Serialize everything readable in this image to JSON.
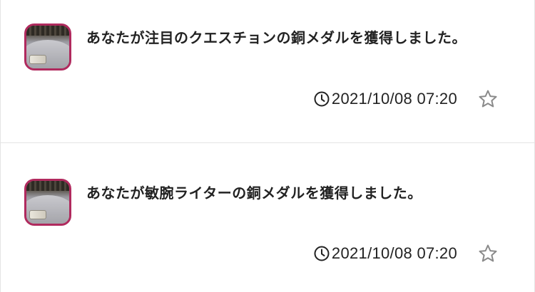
{
  "notifications": [
    {
      "message": "あなたが注目のクエスチョンの銅メダルを獲得しました。",
      "timestamp": "2021/10/08 07:20",
      "avatar_icon": "user-avatar-car",
      "time_icon": "clock-icon",
      "favorite_icon": "star-outline-icon"
    },
    {
      "message": "あなたが敏腕ライターの銅メダルを獲得しました。",
      "timestamp": "2021/10/08 07:20",
      "avatar_icon": "user-avatar-car",
      "time_icon": "clock-icon",
      "favorite_icon": "star-outline-icon"
    }
  ],
  "colors": {
    "avatar_border": "#b02a5e",
    "text": "#222222",
    "star": "#8a8a8a",
    "divider": "#e4e4e4"
  }
}
